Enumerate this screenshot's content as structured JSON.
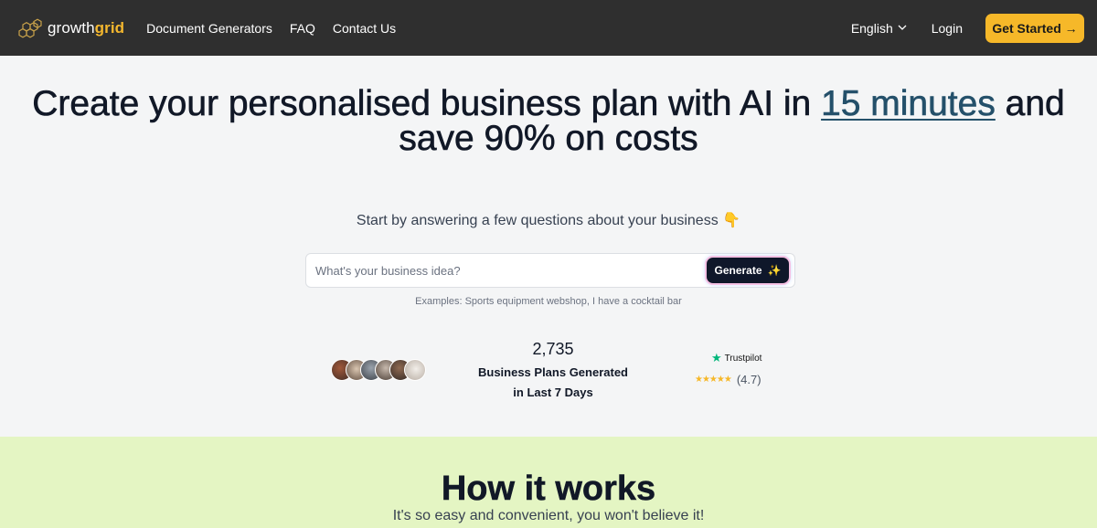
{
  "nav": {
    "logo_text_1": "growth",
    "logo_text_2": "grid",
    "links": [
      "Document Generators",
      "FAQ",
      "Contact Us"
    ],
    "language": "English",
    "login": "Login",
    "get_started": "Get Started →"
  },
  "hero": {
    "title_part1": "Create your personalised business plan with AI in ",
    "title_highlight": "15 minutes",
    "title_part2": " and save 90% on costs",
    "subtitle": "Start by answering a few questions about your business",
    "subtitle_emoji": "👇",
    "search_placeholder": "What's your business idea?",
    "generate_label": "Generate",
    "generate_icon": "✨",
    "examples": "Examples: Sports equipment webshop, I have a cocktail bar"
  },
  "stats": {
    "count": "2,735",
    "label_line1": "Business Plans Generated",
    "label_line2": "in Last 7 Days"
  },
  "trustpilot": {
    "brand": "Trustpilot",
    "score": "(4.7)",
    "rating": 4.7
  },
  "how_it_works": {
    "title": "How it works",
    "subtitle": "It's so easy and convenient, you won't believe it!"
  },
  "colors": {
    "nav_bg": "#2f2f2f",
    "accent": "#f6b829",
    "highlight": "#24506a",
    "how_bg": "#e4f5c3"
  },
  "icons": {
    "logo": "honeycomb-icon",
    "language": "chevron-down-icon",
    "trustpilot": "star-icon",
    "generate": "sparkles-icon"
  }
}
